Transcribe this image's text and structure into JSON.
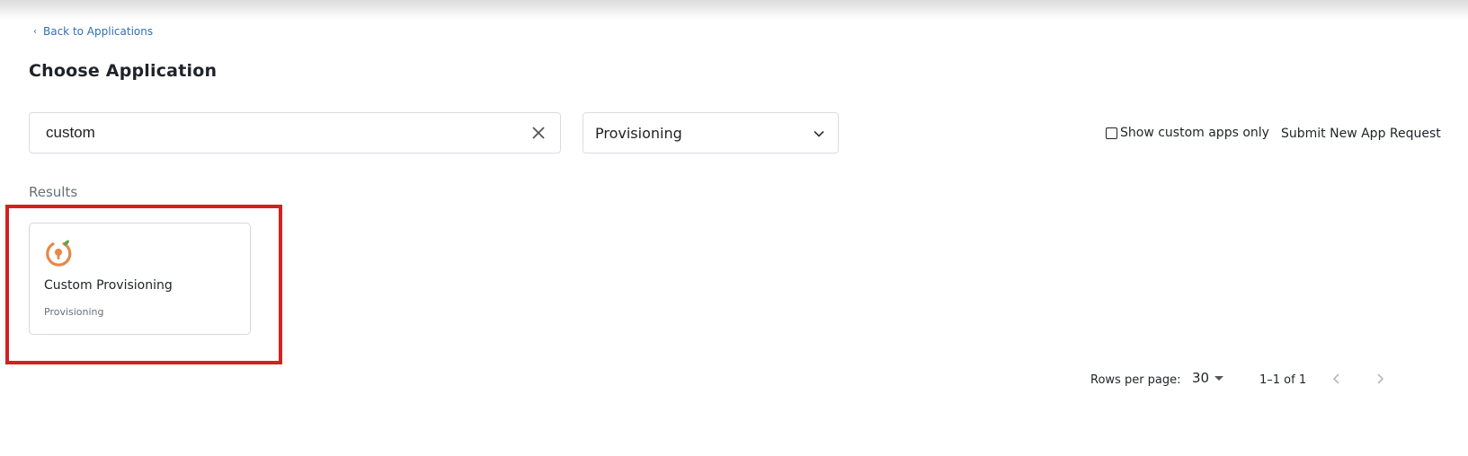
{
  "nav": {
    "back_label": "Back to Applications"
  },
  "header": {
    "title": "Choose Application"
  },
  "filters": {
    "search_value": "custom",
    "category_selected": "Provisioning",
    "custom_only_label": "Show custom apps only",
    "custom_only_checked": false,
    "submit_request_label": "Submit New App Request"
  },
  "results": {
    "label": "Results",
    "items": [
      {
        "name": "Custom Provisioning",
        "category": "Provisioning",
        "icon": "keyhole-provisioning-icon"
      }
    ]
  },
  "pagination": {
    "rows_per_page_label": "Rows per page:",
    "rows_per_page_value": "30",
    "range_label": "1–1 of 1"
  },
  "colors": {
    "link": "#2f6fb5",
    "highlight": "#d42020",
    "icon_orange": "#e8874a",
    "icon_green": "#5aa64a"
  }
}
